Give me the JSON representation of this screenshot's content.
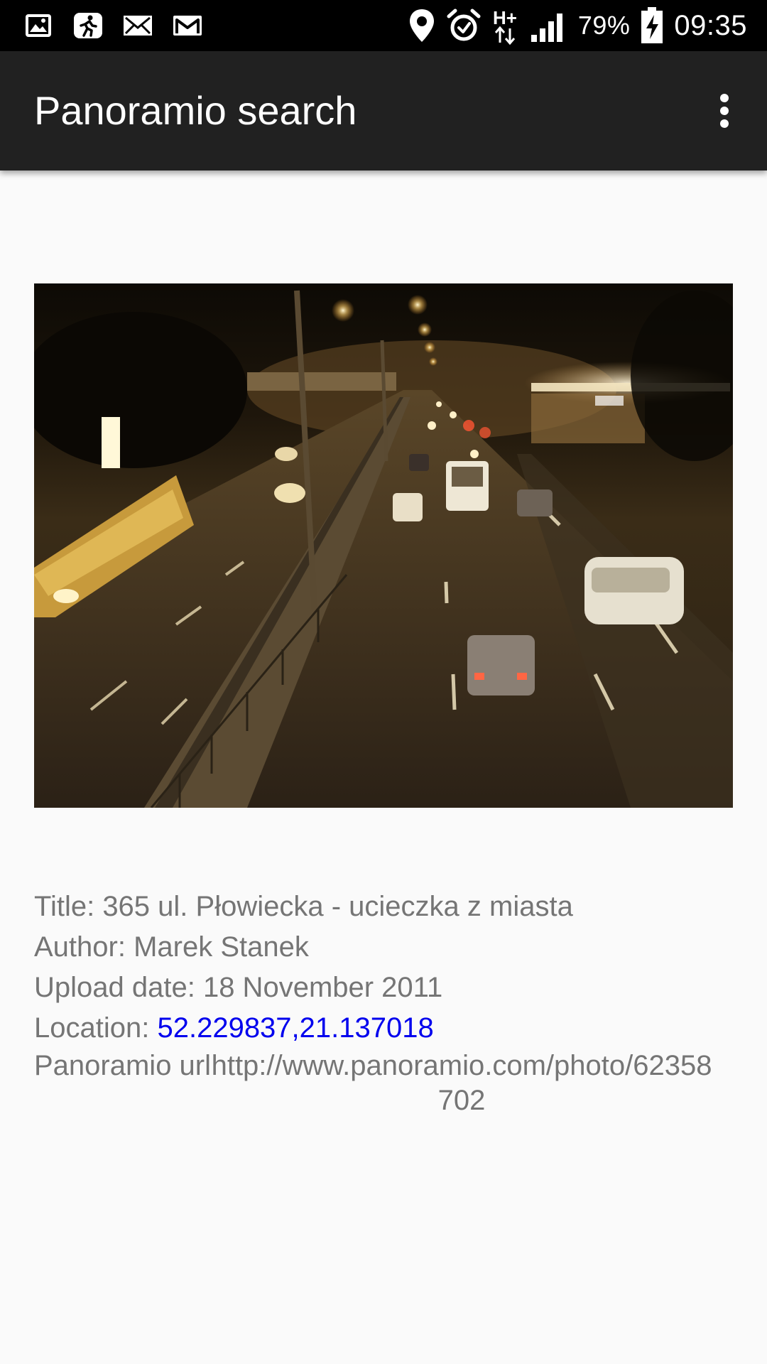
{
  "status_bar": {
    "left_icons": [
      "gallery-icon",
      "running-person-icon",
      "mail-icon",
      "gmail-icon"
    ],
    "right_icons": [
      "location-pin-icon",
      "alarm-clock-icon",
      "hplus-data-icon",
      "signal-icon",
      "battery-charging-icon"
    ],
    "network": "H+",
    "battery": "79%",
    "time": "09:35"
  },
  "app_bar": {
    "title": "Panoramio search",
    "menu_icon": "overflow-menu-icon"
  },
  "photo": {
    "description_icon": "photo-image"
  },
  "details": {
    "title_label": "Title: ",
    "title_value": "365 ul. Płowiecka - ucieczka z miasta",
    "author_label": "Author: ",
    "author_value": "Marek Stanek",
    "upload_label": "Upload date: ",
    "upload_value": "18 November 2011",
    "location_label": "Location: ",
    "location_value": "52.229837,21.137018",
    "url_label": "Panoramio url",
    "url_value": "http://www.panoramio.com/photo/62358702"
  },
  "colors": {
    "app_bar": "#212121",
    "background": "#fafafa",
    "text": "#757575",
    "link": "#0000ee"
  }
}
